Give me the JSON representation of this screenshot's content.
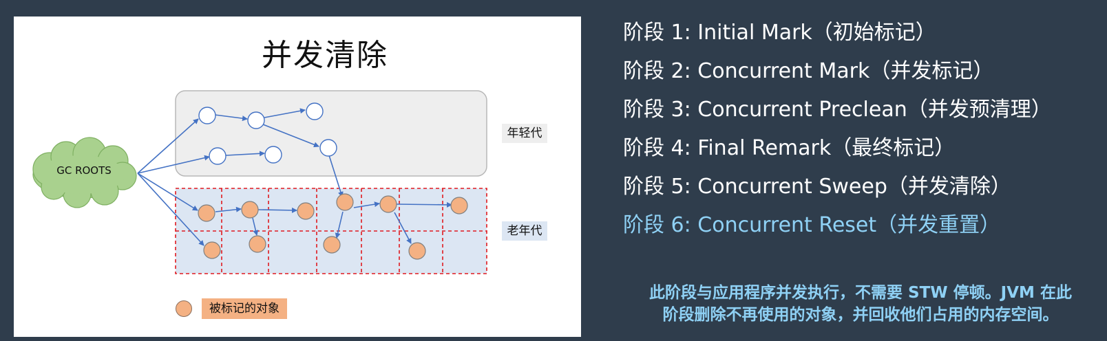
{
  "diagram": {
    "title": "并发清除",
    "gc_roots_label": "GC ROOTS",
    "young_gen_label": "年轻代",
    "old_gen_label": "老年代",
    "legend_label": "被标记的对象"
  },
  "colors": {
    "background": "#2f3d4c",
    "marked_object": "#f4b183",
    "old_gen_fill": "#dce6f3",
    "grid_border": "#e0191f",
    "arrow": "#4472c4",
    "cloud_fill": "#a9d18e",
    "active_phase": "#8fd1f5"
  },
  "phases": [
    {
      "label": "阶段 1: Initial Mark（初始标记）",
      "active": false
    },
    {
      "label": "阶段 2: Concurrent Mark（并发标记）",
      "active": false
    },
    {
      "label": "阶段 3: Concurrent Preclean（并发预清理）",
      "active": false
    },
    {
      "label": "阶段 4: Final Remark（最终标记）",
      "active": false
    },
    {
      "label": "阶段 5: Concurrent Sweep（并发清除）",
      "active": false
    },
    {
      "label": "阶段 6: Concurrent Reset（并发重置）",
      "active": true
    }
  ],
  "note": {
    "line1": "此阶段与应用程序并发执行，不需要 STW 停顿。JVM 在此",
    "line2": "阶段删除不再使用的对象，并回收他们占用的内存空间。"
  }
}
